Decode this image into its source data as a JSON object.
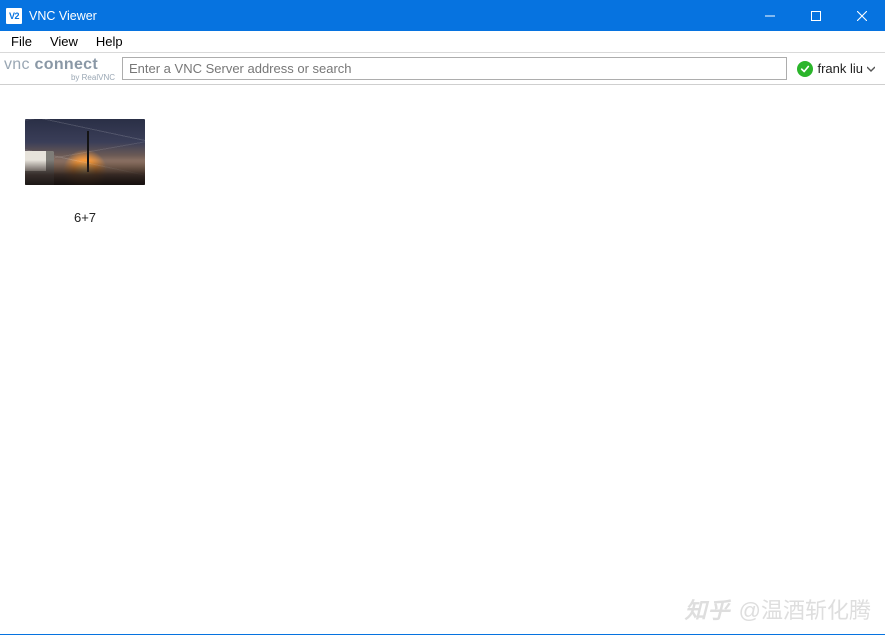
{
  "window": {
    "title": "VNC Viewer",
    "icon_label": "V2"
  },
  "menu": {
    "file": "File",
    "view": "View",
    "help": "Help"
  },
  "brand": {
    "line1_prefix": "vnc ",
    "line1_bold": "connect",
    "line2": "by RealVNC"
  },
  "search": {
    "value": "",
    "placeholder": "Enter a VNC Server address or search"
  },
  "user": {
    "status_icon_name": "check-icon",
    "name": "frank liu"
  },
  "connections": [
    {
      "label": "6+7"
    }
  ],
  "watermark": {
    "site": "知乎",
    "author_prefix": "@",
    "author": "温酒斩化腾"
  }
}
